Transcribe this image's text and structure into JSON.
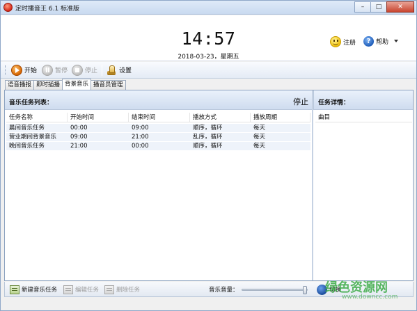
{
  "window": {
    "title": "定时播音王 6.1 标准版",
    "minimize_glyph": "–",
    "maximize_glyph": "□",
    "close_glyph": "✕"
  },
  "header": {
    "time": "14:57",
    "date": "2018-03-23，星期五",
    "register_label": "注册",
    "help_label": "帮助"
  },
  "toolbar": {
    "start_label": "开始",
    "pause_label": "暂停",
    "stop_label": "停止",
    "settings_label": "设置"
  },
  "tabs": [
    {
      "label": "语音播报"
    },
    {
      "label": "即时插播"
    },
    {
      "label": "背景音乐"
    },
    {
      "label": "播音员管理"
    }
  ],
  "left_panel": {
    "title": "音乐任务列表：",
    "status": "停止",
    "columns": [
      "任务名称",
      "开始时间",
      "结束时间",
      "播放方式",
      "播放周期"
    ],
    "rows": [
      [
        "晨间音乐任务",
        "00:00",
        "09:00",
        "顺序，循环",
        "每天"
      ],
      [
        "营业期间背景音乐",
        "09:00",
        "21:00",
        "乱序，循环",
        "每天"
      ],
      [
        "晚间音乐任务",
        "21:00",
        "00:00",
        "顺序，循环",
        "每天"
      ]
    ]
  },
  "right_panel": {
    "title": "任务详情：",
    "column": "曲目"
  },
  "bottom": {
    "new_task_label": "新建音乐任务",
    "edit_task_label": "编辑任务",
    "delete_task_label": "删除任务",
    "volume_label": "音乐音量：",
    "volume_level": 1.0,
    "switch_label": "切换"
  },
  "watermark": {
    "text": "绿色资源网",
    "sub": "www.downcc.com"
  },
  "colors": {
    "accent": "#cfdcef",
    "close_button": "#c8452f",
    "start_orange": "#d56400",
    "watermark_green": "#3caa46"
  }
}
